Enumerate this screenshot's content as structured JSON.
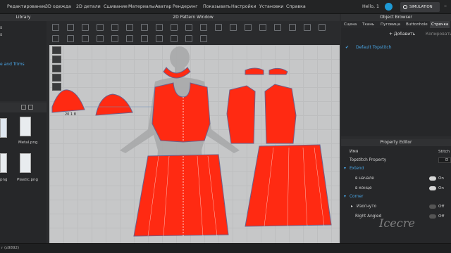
{
  "menubar": {
    "items": [
      "Редактирование",
      "3D одежда",
      "2D детали",
      "Сшивание",
      "Материалы",
      "Аватар",
      "Рендеринг",
      "Показывать",
      "Настройки",
      "Установки",
      "Справка"
    ],
    "user_greeting": "Hello, 1",
    "simulation_label": "SIMULATION"
  },
  "library": {
    "title": "Library",
    "list_fragment_1": "s",
    "list_fragment_2": "e and Trims",
    "items": [
      {
        "label": "Metal.png"
      },
      {
        "label": "png"
      },
      {
        "label": "Plastic.png"
      }
    ]
  },
  "pattern_window": {
    "title": "2D Pattern Window",
    "measure_label": "20 1 8"
  },
  "object_browser": {
    "title": "Object Browser",
    "tabs": [
      "Сцена",
      "Ткань",
      "Пуговица",
      "Buttonhole",
      "Строчка"
    ],
    "active_tab": "Строчка",
    "add_label": "+ Добавить",
    "copy_label": "Копировать",
    "item": "Default Topstitch"
  },
  "property_editor": {
    "title": "Property Editor",
    "rows": [
      {
        "label": "Имя",
        "value": "Stitch"
      },
      {
        "label": "Topstitch Property",
        "value": "D"
      },
      {
        "label": "Extend",
        "section": true
      },
      {
        "label": "в начале",
        "value": "On",
        "toggle": "on"
      },
      {
        "label": "в конце",
        "value": "On",
        "toggle": "on"
      },
      {
        "label": "Corner",
        "section": true
      },
      {
        "label": "Изогнуто",
        "value": "Off",
        "toggle": "off"
      },
      {
        "label": "Right Angled",
        "value": "Off",
        "toggle": "off"
      }
    ]
  },
  "status": {
    "text": "r (z9892)"
  },
  "watermark": "Icecre",
  "colors": {
    "garment": "#ff2a12",
    "accent": "#1e9ad6",
    "section": "#49a6e6"
  }
}
